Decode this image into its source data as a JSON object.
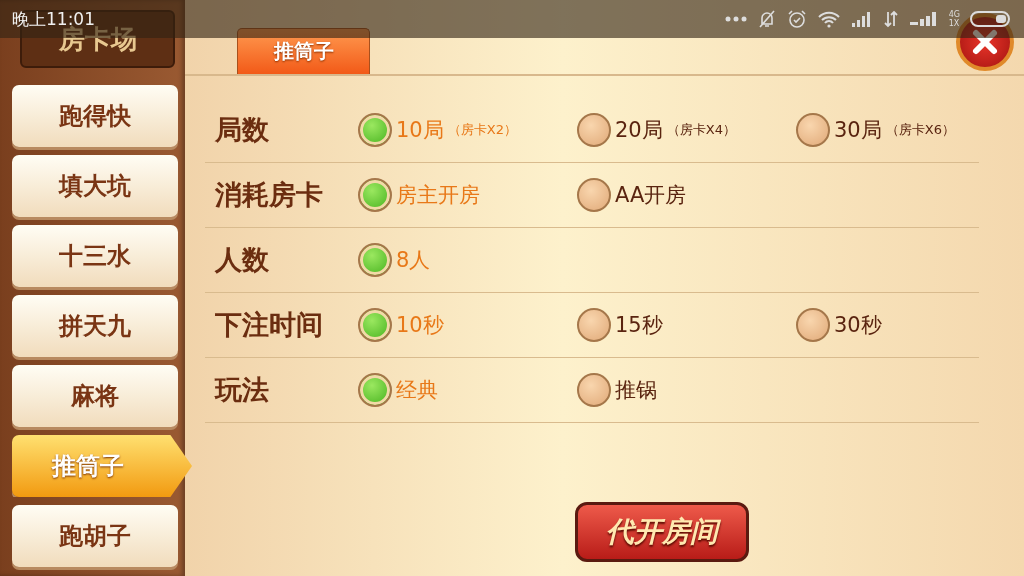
{
  "status_bar": {
    "time": "晚上11:01",
    "network_top": "4G",
    "network_bottom": "1X"
  },
  "sidebar": {
    "title": "房卡场",
    "items": [
      {
        "label": "跑得快",
        "selected": false
      },
      {
        "label": "填大坑",
        "selected": false
      },
      {
        "label": "十三水",
        "selected": false
      },
      {
        "label": "拼天九",
        "selected": false
      },
      {
        "label": "麻将",
        "selected": false
      },
      {
        "label": "推筒子",
        "selected": true
      },
      {
        "label": "跑胡子",
        "selected": false
      }
    ]
  },
  "tab": {
    "label": "推筒子",
    "selected": true
  },
  "settings": [
    {
      "label": "局数",
      "options": [
        {
          "label": "10局",
          "note": "（房卡X2）",
          "selected": true
        },
        {
          "label": "20局",
          "note": "（房卡X4）",
          "selected": false
        },
        {
          "label": "30局",
          "note": "（房卡X6）",
          "selected": false
        }
      ]
    },
    {
      "label": "消耗房卡",
      "options": [
        {
          "label": "房主开房",
          "selected": true
        },
        {
          "label": "AA开房",
          "selected": false
        }
      ]
    },
    {
      "label": "人数",
      "options": [
        {
          "label": "8人",
          "selected": true
        }
      ]
    },
    {
      "label": "下注时间",
      "options": [
        {
          "label": "10秒",
          "selected": true
        },
        {
          "label": "15秒",
          "selected": false
        },
        {
          "label": "30秒",
          "selected": false
        }
      ]
    },
    {
      "label": "玩法",
      "options": [
        {
          "label": "经典",
          "selected": true
        },
        {
          "label": "推锅",
          "selected": false
        }
      ]
    }
  ],
  "buttons": [
    {
      "label": "代开房间"
    }
  ]
}
